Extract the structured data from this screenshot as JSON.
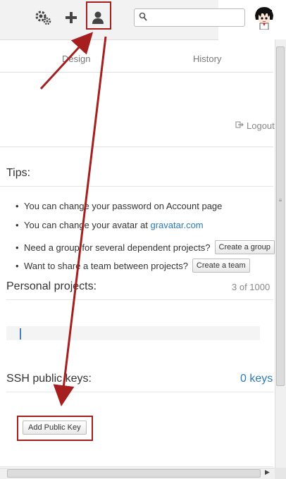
{
  "header": {
    "search_placeholder": "",
    "icons": [
      "gears-icon",
      "plus-icon",
      "user-icon",
      "search-icon",
      "avatar"
    ]
  },
  "tabs": [
    {
      "label": "Design"
    },
    {
      "label": "History"
    }
  ],
  "logout": {
    "label": "Logout"
  },
  "tips": {
    "title": "Tips:",
    "items": [
      {
        "text": "You can change your password on Account page"
      },
      {
        "text": "You can change your avatar at ",
        "link": "gravatar.com"
      },
      {
        "text": "Need a group for several dependent projects?",
        "button": "Create a group"
      },
      {
        "text": "Want to share a team between projects?",
        "button": "Create a team"
      }
    ]
  },
  "personal_projects": {
    "title": "Personal projects:",
    "count": "3 of 1000"
  },
  "ssh_keys": {
    "title": "SSH public keys:",
    "count": "0 keys",
    "add_button": "Add Public Key"
  },
  "colors": {
    "link": "#2b7bb9",
    "annotation": "#a51f1f"
  }
}
